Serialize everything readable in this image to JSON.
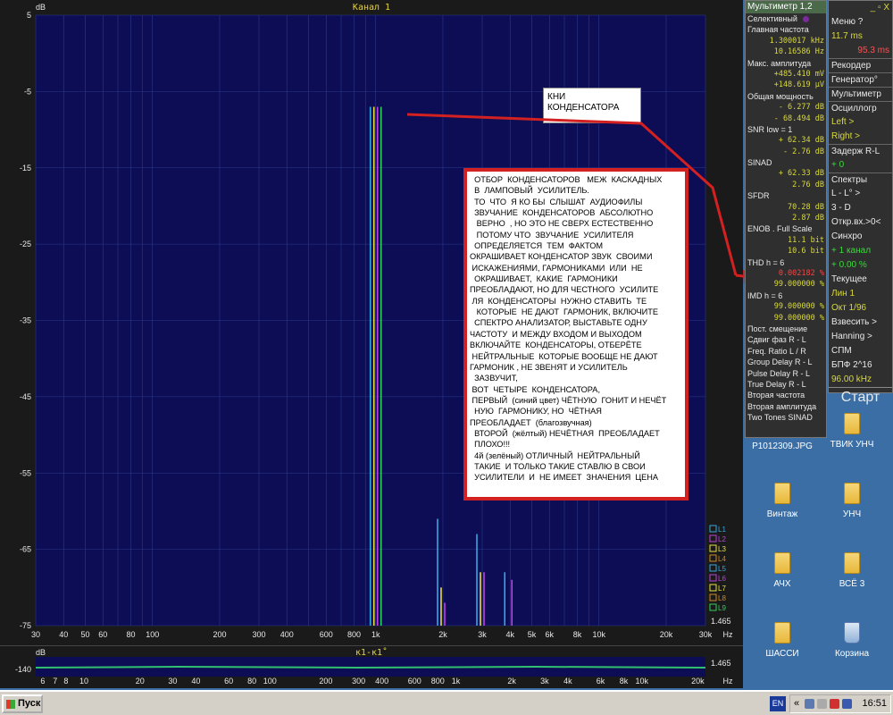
{
  "chart": {
    "channel_title": "Канал 1",
    "ylabel": "dB",
    "ytick_labels": [
      "5",
      "-5",
      "-15",
      "-25",
      "-35",
      "-45",
      "-55",
      "-65",
      "-75"
    ],
    "xtick_labels": [
      "30",
      "40",
      "50",
      "60",
      "80",
      "100",
      "200",
      "300",
      "400",
      "600",
      "800",
      "1k",
      "2k",
      "3k",
      "4k",
      "5k",
      "6k",
      "8k",
      "10k",
      "20k",
      "30k",
      "Hz"
    ],
    "legend": [
      "L1",
      "L2",
      "L3",
      "L4",
      "L5",
      "L6",
      "L7",
      "L8",
      "L9"
    ],
    "corner_value": "1.465",
    "colors": {
      "plot_bg": "#0d0d55",
      "grid": "#2a3a8a",
      "blue": "#35a8e0",
      "yellow": "#e8e040",
      "purple": "#c040e0",
      "green": "#30d060",
      "red": "#d32020"
    }
  },
  "chart_data": {
    "type": "line",
    "title": "Канал 1",
    "ylabel": "dB",
    "x_scale": "log",
    "xlim": [
      30,
      30000
    ],
    "ylim": [
      -75,
      5
    ],
    "grid": true,
    "series": [
      {
        "name": "L1",
        "color": "#35a8e0",
        "x": [
          1000,
          2000,
          3000,
          4000
        ],
        "y": [
          -7,
          -61,
          -63,
          -68
        ]
      },
      {
        "name": "L3",
        "color": "#e8e040",
        "x": [
          1000,
          2000,
          3000
        ],
        "y": [
          -7,
          -70,
          -68
        ]
      },
      {
        "name": "L2",
        "color": "#c040e0",
        "x": [
          1000,
          2000,
          3000,
          4000
        ],
        "y": [
          -7,
          -72,
          -68,
          -69
        ]
      },
      {
        "name": "L4",
        "color": "#30d060",
        "x": [
          1000
        ],
        "y": [
          -7
        ]
      }
    ]
  },
  "strip": {
    "title": "к1-к1˚",
    "ylabel": "dB",
    "ytick_label": "-140",
    "xtick_labels": [
      "6",
      "7",
      "8",
      "10",
      "20",
      "30",
      "40",
      "60",
      "80",
      "100",
      "200",
      "300",
      "400",
      "600",
      "800",
      "1k",
      "2k",
      "3k",
      "4k",
      "6k",
      "8k",
      "10k",
      "20k",
      "Hz"
    ],
    "corner_value": "1.465"
  },
  "notes": {
    "small": [
      "КНИ",
      "КОНДЕНСАТОРА"
    ],
    "big": [
      "  ОТБОР  КОНДЕНСАТОРОВ   МЕЖ  КАСКАДНЫХ",
      "  В  ЛАМПОВЫЙ  УСИЛИТЕЛЬ.",
      "  ТО  ЧТО  Я КО БЫ  СЛЫШАТ  АУДИОФИЛЫ",
      "  ЗВУЧАНИЕ  КОНДЕНСАТОРОВ  АБСОЛЮТНО",
      "   ВЕРНО  , НО ЭТО НЕ СВЕРХ ЕСТЕСТВЕННО",
      "   ПОТОМУ ЧТО  ЗВУЧАНИЕ  УСИЛИТЕЛЯ",
      "  ОПРЕДЕЛЯЕТСЯ  ТЕМ  ФАКТОМ",
      "ОКРАШИВАЕТ КОНДЕНСАТОР ЗВУК  СВОИМИ",
      " ИСКАЖЕНИЯМИ, ГАРМОНИКАМИ  ИЛИ  НЕ",
      "  ОКРАШИВАЕТ,  КАКИЕ  ГАРМОНИКИ",
      "ПРЕОБЛАДАЮТ, НО ДЛЯ ЧЕСТНОГО  УСИЛИТЕ",
      " ЛЯ  КОНДЕНСАТОРЫ  НУЖНО СТАВИТЬ  ТЕ",
      "   КОТОРЫЕ  НЕ ДАЮТ  ГАРМОНИК, ВКЛЮЧИТЕ",
      "  СПЕКТРО АНАЛИЗАТОР, ВЫСТАВЬТЕ ОДНУ",
      "ЧАСТОТУ  И МЕЖДУ ВХОДОМ И ВЫХОДОМ",
      "ВКЛЮЧАЙТЕ  КОНДЕНСАТОРЫ, ОТБЕРЁТЕ",
      " НЕЙТРАЛЬНЫЕ  КОТОРЫЕ ВООБЩЕ НЕ ДАЮТ",
      "ГАРМОНИК , НЕ ЗВЕНЯТ И УСИЛИТЕЛЬ",
      "  ЗАЗВУЧИТ,",
      " ВОТ  ЧЕТЫРЕ  КОНДЕНСАТОРА,",
      " ПЕРВЫЙ  (синий цвет) ЧЁТНУЮ  ГОНИТ И НЕЧЁТ",
      "  НУЮ  ГАРМОНИКУ, НО  ЧЁТНАЯ",
      "ПРЕОБЛАДАЕТ  (благозвучная)",
      "  ВТОРОЙ  (жёлтый) НЕЧЁТНАЯ  ПРЕОБЛАДАЕТ",
      "  ПЛОХО!!!",
      "  4й (зелёный) ОТЛИЧНЫЙ  НЕЙТРАЛЬНЫЙ",
      "  ТАКИЕ  И ТОЛЬКО ТАКИЕ СТАВЛЮ В СВОИ",
      "  УСИЛИТЕЛИ  И  НЕ ИМЕЕТ  ЗНАЧЕНИЯ  ЦЕНА"
    ]
  },
  "multimeter": {
    "title": "Мультиметр 1,2",
    "rows": [
      {
        "label": "Селективный",
        "value": "",
        "kind": "label"
      },
      {
        "label": "Главная частота",
        "value": "",
        "kind": "label"
      },
      {
        "label": "",
        "value": "1.300017 kHz",
        "kind": "val"
      },
      {
        "label": "",
        "value": "10.16586 Hz",
        "kind": "val"
      },
      {
        "label": "Макс. амплитуда",
        "value": "",
        "kind": "label"
      },
      {
        "label": "",
        "value": "+485.410 mV",
        "kind": "val"
      },
      {
        "label": "",
        "value": "+148.619 μV",
        "kind": "val"
      },
      {
        "label": "Общая мощность",
        "value": "",
        "kind": "label"
      },
      {
        "label": "",
        "value": "-   6.277 dB",
        "kind": "val"
      },
      {
        "label": "",
        "value": "-  68.494 dB",
        "kind": "val"
      },
      {
        "label": "SNR      low = 1",
        "value": "",
        "kind": "label"
      },
      {
        "label": "",
        "value": "+  62.34 dB",
        "kind": "val"
      },
      {
        "label": "",
        "value": "-   2.76 dB",
        "kind": "val"
      },
      {
        "label": "SINAD",
        "value": "",
        "kind": "label"
      },
      {
        "label": "",
        "value": "+  62.33 dB",
        "kind": "val"
      },
      {
        "label": "",
        "value": "   2.76 dB",
        "kind": "val"
      },
      {
        "label": "SFDR",
        "value": "",
        "kind": "label"
      },
      {
        "label": "",
        "value": "70.28 dB",
        "kind": "val"
      },
      {
        "label": "",
        "value": "2.87 dB",
        "kind": "val"
      },
      {
        "label": "ENOB . Full Scale",
        "value": "",
        "kind": "label"
      },
      {
        "label": "",
        "value": "11.1 bit",
        "kind": "val"
      },
      {
        "label": "",
        "value": "10.6 bit",
        "kind": "val"
      },
      {
        "label": "THD         h =  6",
        "value": "",
        "kind": "label"
      },
      {
        "label": "",
        "value": "0.002182 %",
        "kind": "val"
      },
      {
        "label": "",
        "value": "99.000000 %",
        "kind": "val"
      },
      {
        "label": "IMD         h =  6",
        "value": "",
        "kind": "label"
      },
      {
        "label": "",
        "value": "99.000000 %",
        "kind": "val"
      },
      {
        "label": "",
        "value": "99.000000 %",
        "kind": "val"
      },
      {
        "label": "Пост. смещение",
        "value": "",
        "kind": "label"
      },
      {
        "label": "Сдвиг фаз R - L",
        "value": "",
        "kind": "label"
      },
      {
        "label": "Freq. Ratio  L / R",
        "value": "",
        "kind": "label"
      },
      {
        "label": "Group Delay R - L",
        "value": "",
        "kind": "label"
      },
      {
        "label": "Pulse Delay R - L",
        "value": "",
        "kind": "label"
      },
      {
        "label": "True  Delay R - L",
        "value": "",
        "kind": "label"
      },
      {
        "label": "Вторая частота",
        "value": "",
        "kind": "label"
      },
      {
        "label": "Вторая амплитуда",
        "value": "",
        "kind": "label"
      },
      {
        "label": "Two Tones SINAD",
        "value": "",
        "kind": "label"
      }
    ]
  },
  "menu": {
    "top_icons": "_ ▫ X",
    "items": [
      {
        "label": "Меню      ?",
        "cls": ""
      },
      {
        "label": "      11.7 ms",
        "cls": "yellow"
      },
      {
        "label": "      95.3 ms",
        "cls": "red"
      },
      {
        "label": " Рекордер",
        "cls": "btn"
      },
      {
        "label": " Генератор°",
        "cls": "btn"
      },
      {
        "label": "Мультиметр",
        "cls": "btn"
      },
      {
        "label": " Осциллогр",
        "cls": "btn"
      },
      {
        "label": "   Left    >",
        "cls": "yellow"
      },
      {
        "label": "   Right   >",
        "cls": "yellow"
      },
      {
        "label": "Задерж R-L",
        "cls": "btn"
      },
      {
        "label": "+        0",
        "cls": "green"
      },
      {
        "label": "Спектры",
        "cls": "btn"
      },
      {
        "label": "   L - L°  >",
        "cls": ""
      },
      {
        "label": "     3 - D",
        "cls": ""
      },
      {
        "label": "Откр.вх.>0<",
        "cls": ""
      },
      {
        "label": "  Синхро",
        "cls": ""
      },
      {
        "label": "+ 1 канал",
        "cls": "green"
      },
      {
        "label": "+  0.00 %",
        "cls": "green"
      },
      {
        "label": "  Текущее",
        "cls": ""
      },
      {
        "label": "  Лин    1",
        "cls": "yellow"
      },
      {
        "label": " Окт  1/96",
        "cls": "yellow"
      },
      {
        "label": " Взвесить >",
        "cls": ""
      },
      {
        "label": " Hanning  >",
        "cls": ""
      },
      {
        "label": " СПМ",
        "cls": ""
      },
      {
        "label": "БПФ 2^16",
        "cls": ""
      },
      {
        "label": "96.00 kHz",
        "cls": "yellow"
      }
    ],
    "start": "Старт"
  },
  "desktop": {
    "icons": [
      {
        "label": "P1012309.JPG",
        "type": "doc"
      },
      {
        "label": "ТВИК  УНЧ",
        "type": "folder"
      },
      {
        "label": "Винтаж",
        "type": "folder"
      },
      {
        "label": "УНЧ",
        "type": "folder"
      },
      {
        "label": "АЧХ",
        "type": "folder"
      },
      {
        "label": "ВСЁ 3",
        "type": "folder"
      },
      {
        "label": "ШАССИ",
        "type": "folder"
      },
      {
        "label": "Корзина",
        "type": "bin"
      }
    ]
  },
  "taskbar": {
    "start_label": "Пуск",
    "lang": "EN",
    "clock": "16:51",
    "tray_arrow": "«"
  }
}
